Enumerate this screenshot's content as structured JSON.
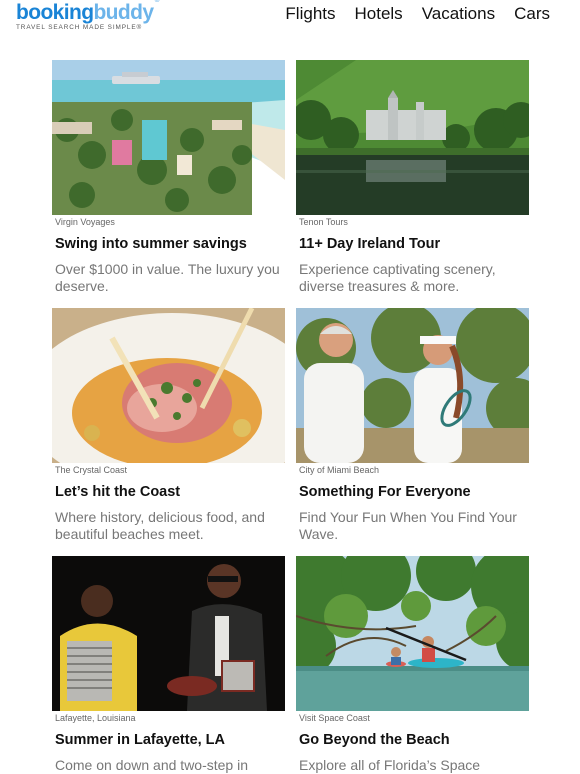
{
  "brand": {
    "logo_part1": "booking",
    "logo_part2": "buddy",
    "registered": "®",
    "tagline": "TRAVEL SEARCH MADE SIMPLE®"
  },
  "nav": {
    "items": [
      "Flights",
      "Hotels",
      "Vacations",
      "Cars"
    ]
  },
  "cards": [
    {
      "sponsor": "Virgin Voyages",
      "title": "Swing into summer savings",
      "description": "Over $1000 in value. The luxury you deserve.",
      "image": "resort-beach-aerial-photo"
    },
    {
      "sponsor": "Tenon Tours",
      "title": "11+ Day Ireland Tour",
      "description": "Experience captivating scenery, diverse treasures & more.",
      "image": "abbey-lake-photo"
    },
    {
      "sponsor": "The Crystal Coast",
      "title": "Let’s hit the Coast",
      "description": "Where history, delicious food, and beautiful beaches meet.",
      "image": "seafood-dish-photo"
    },
    {
      "sponsor": "City of Miami Beach",
      "title": "Something For Everyone",
      "description": "Find Your Fun When You Find Your Wave.",
      "image": "tennis-players-photo"
    },
    {
      "sponsor": "Lafayette, Louisiana",
      "title": "Summer in Lafayette, LA",
      "description": "Come on down and two-step in",
      "image": "musicians-photo"
    },
    {
      "sponsor": "Visit Space Coast",
      "title": "Go Beyond the Beach",
      "description": "Explore all of Florida’s Space",
      "image": "kayak-mangrove-photo"
    }
  ]
}
